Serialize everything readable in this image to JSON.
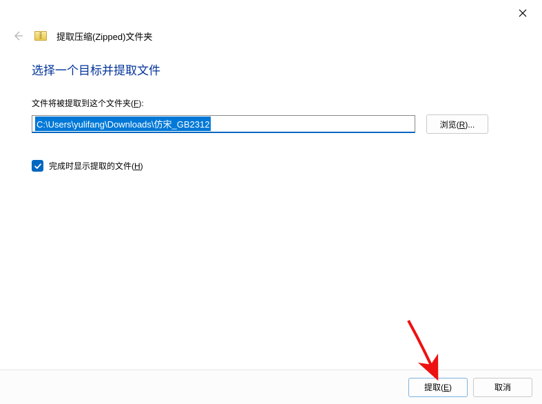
{
  "window": {
    "title": "提取压缩(Zipped)文件夹"
  },
  "main": {
    "heading": "选择一个目标并提取文件",
    "path_label_prefix": "文件将被提取到这个文件夹(",
    "path_label_hotkey": "F",
    "path_label_suffix": "):",
    "path_value": "C:\\Users\\yulifang\\Downloads\\仿宋_GB2312",
    "browse_prefix": "浏览(",
    "browse_hotkey": "R",
    "browse_suffix": ")...",
    "checkbox_checked": true,
    "checkbox_label_prefix": "完成时显示提取的文件(",
    "checkbox_label_hotkey": "H",
    "checkbox_label_suffix": ")"
  },
  "footer": {
    "extract_prefix": "提取(",
    "extract_hotkey": "E",
    "extract_suffix": ")",
    "cancel": "取消"
  }
}
